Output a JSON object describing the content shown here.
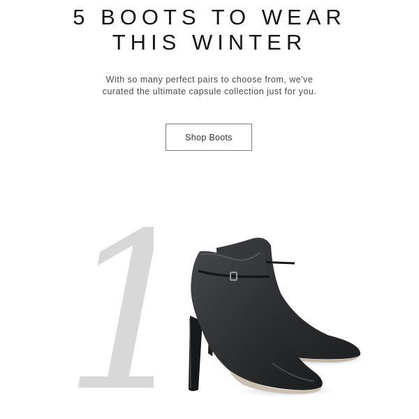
{
  "headline": {
    "line1": "5 BOOTS TO WEAR",
    "line2": "THIS WINTER"
  },
  "subtitle": {
    "line1": "With so many perfect pairs to choose from, we've",
    "line2": "curated the ultimate capsule collection just for you."
  },
  "cta": {
    "label": "Shop Boots"
  },
  "feature": {
    "number": "1",
    "image_subject": "black-leather-ankle-boots-icon"
  },
  "colors": {
    "text": "#151515",
    "numeral": "#d8d8d8",
    "boot": "#2c2e30",
    "button_border": "#7a7a7a"
  }
}
